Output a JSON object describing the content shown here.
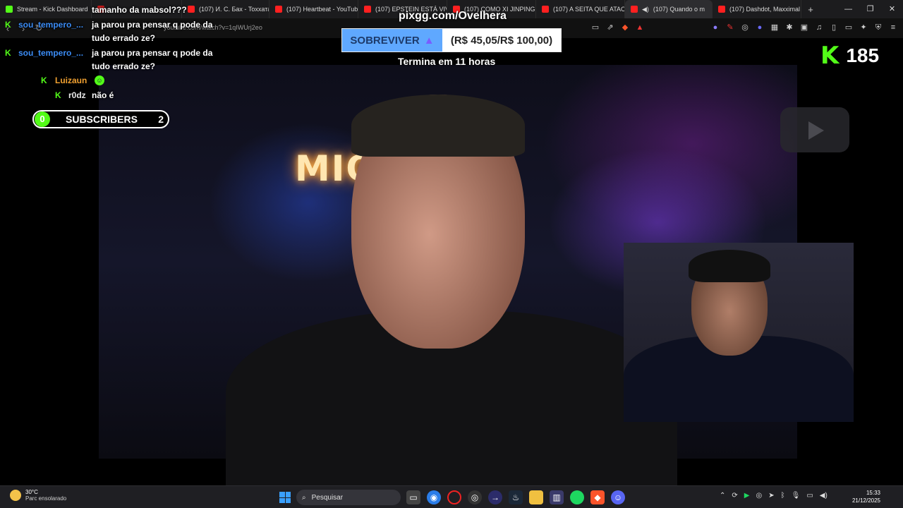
{
  "browser": {
    "tabs": [
      {
        "title": "Stream - Kick Dashboard",
        "fav": "#53fc18"
      },
      {
        "title": "",
        "fav": "#cc1b1b"
      },
      {
        "title": "(107) И. С. Бах - Toxxата и",
        "fav": "#ff2020"
      },
      {
        "title": "(107) Heartbeat - YouTube",
        "fav": "#ff2020"
      },
      {
        "title": "(107) EPSTEIN ESTÁ VIVO",
        "fav": "#ff2020"
      },
      {
        "title": "(107) COMO XI JINPING C",
        "fav": "#ff2020"
      },
      {
        "title": "(107) A SEITA QUE ATACO",
        "fav": "#ff2020"
      },
      {
        "title": "(107) Quando o m",
        "fav": "#ff2020"
      },
      {
        "title": "(107) Dashdot, Maxximal",
        "fav": "#ff2020"
      }
    ],
    "new_tab": "+",
    "url": "youtube.com/watch?v=1qIWUrj2eo"
  },
  "chat": {
    "line0_text": "tamanho da mabsol???",
    "msg1": {
      "user": "sou_tempero_...",
      "text1": "ja parou pra pensar q pode da",
      "text2": "tudo errado ze?"
    },
    "msg2": {
      "user": "sou_tempero_...",
      "text1": "ja parou pra pensar q pode da",
      "text2": "tudo errado ze?"
    },
    "msg3": {
      "user": "Luizaun"
    },
    "msg4": {
      "user": "r0dz",
      "text": "não é"
    }
  },
  "subs_bar": {
    "current": "0",
    "label": "SUBSCRIBERS",
    "goal": "2"
  },
  "donation": {
    "pix": "pixgg.com/Ovelhera",
    "label": "SOBREVIVER",
    "amount": "(R$ 45,05/R$ 100,00)",
    "progress_pct": 45,
    "ends": "Termina em 11 horas"
  },
  "viewers": {
    "icon": "K",
    "count": "185"
  },
  "video": {
    "sign": "MIOPIA"
  },
  "taskbar": {
    "temp": "30°C",
    "condition": "Parc ensolarado",
    "search_placeholder": "Pesquisar",
    "time": "15:33",
    "date": "21/12/2025"
  },
  "colors": {
    "kick_green": "#53fc18",
    "goal_blue": "#5fa8ff"
  }
}
